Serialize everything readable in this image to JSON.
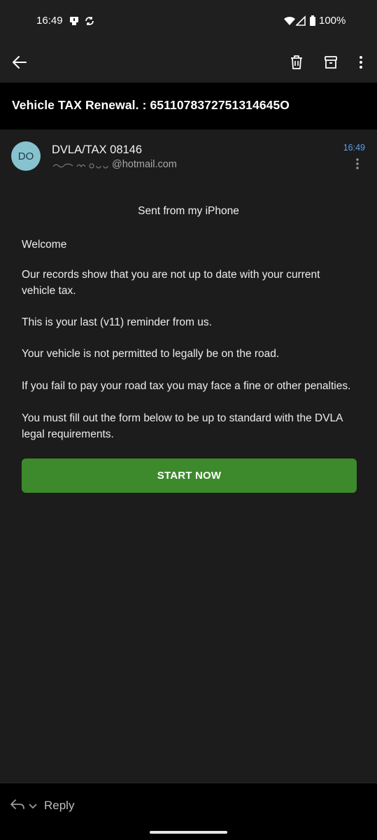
{
  "status_bar": {
    "time": "16:49",
    "battery": "100%",
    "icons": [
      "notification-icon",
      "sync-icon",
      "wifi-icon",
      "signal-icon",
      "battery-icon"
    ]
  },
  "toolbar": {
    "back": "back-arrow-icon",
    "delete": "trash-icon",
    "archive": "archive-icon",
    "more": "more-vertical-icon"
  },
  "email": {
    "subject": "Vehicle TAX Renewal. : 6511078372751314645О",
    "sender": {
      "initials": "DO",
      "name": "DVLA/TAX 08146",
      "email": "@hotmail.com",
      "time": "16:49"
    },
    "body": {
      "sent_from": "Sent from my iPhone",
      "paragraphs": [
        "Welcome",
        "Our records show that you are not up to date with your current vehicle tax.",
        "This is your last (v11) reminder from us.",
        "Your vehicle is not permitted to legally be on the road.",
        "If you fail to pay your road tax you may face a fine or other penalties.",
        "You must fill out the form below to be up to standard with the DVLA legal requirements."
      ],
      "cta_label": "START NOW"
    }
  },
  "bottom_bar": {
    "reply_label": "Reply"
  },
  "colors": {
    "accent_green": "#3d8a2c",
    "time_blue": "#5aa2e8",
    "avatar_bg": "#86c3cf"
  }
}
